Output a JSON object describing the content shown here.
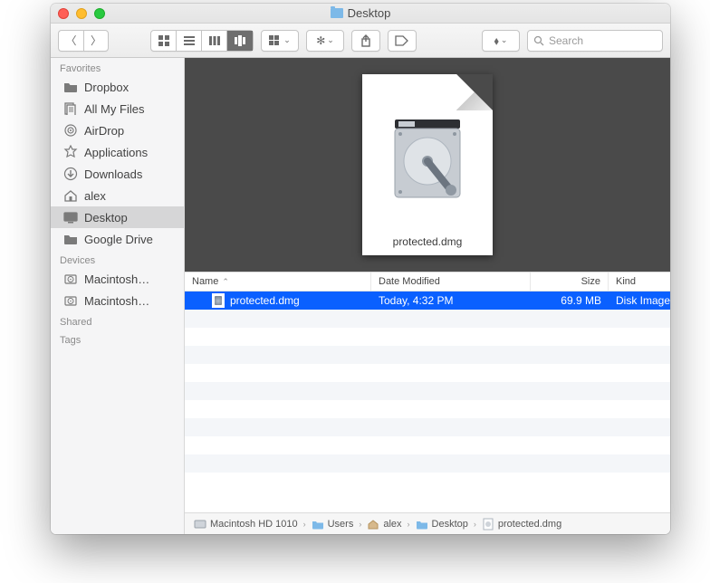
{
  "window": {
    "title": "Desktop"
  },
  "toolbar": {
    "search_placeholder": "Search"
  },
  "sidebar": {
    "sections": [
      {
        "label": "Favorites",
        "items": [
          {
            "icon": "folder",
            "label": "Dropbox"
          },
          {
            "icon": "allfiles",
            "label": "All My Files"
          },
          {
            "icon": "airdrop",
            "label": "AirDrop"
          },
          {
            "icon": "apps",
            "label": "Applications"
          },
          {
            "icon": "downloads",
            "label": "Downloads"
          },
          {
            "icon": "home",
            "label": "alex"
          },
          {
            "icon": "desktop",
            "label": "Desktop",
            "selected": true
          },
          {
            "icon": "folder",
            "label": "Google Drive"
          }
        ]
      },
      {
        "label": "Devices",
        "items": [
          {
            "icon": "hdd",
            "label": "Macintosh…"
          },
          {
            "icon": "hdd",
            "label": "Macintosh…"
          }
        ]
      },
      {
        "label": "Shared",
        "items": []
      },
      {
        "label": "Tags",
        "items": []
      }
    ]
  },
  "preview": {
    "filename": "protected.dmg"
  },
  "columns": {
    "name": "Name",
    "date": "Date Modified",
    "size": "Size",
    "kind": "Kind"
  },
  "rows": [
    {
      "name": "protected.dmg",
      "date": "Today, 4:32 PM",
      "size": "69.9 MB",
      "kind": "Disk Image",
      "selected": true
    }
  ],
  "blank_row_count": 10,
  "path": [
    {
      "icon": "hdd",
      "label": "Macintosh HD 1010"
    },
    {
      "icon": "folder",
      "label": "Users"
    },
    {
      "icon": "home",
      "label": "alex"
    },
    {
      "icon": "folder",
      "label": "Desktop"
    },
    {
      "icon": "doc",
      "label": "protected.dmg"
    }
  ]
}
